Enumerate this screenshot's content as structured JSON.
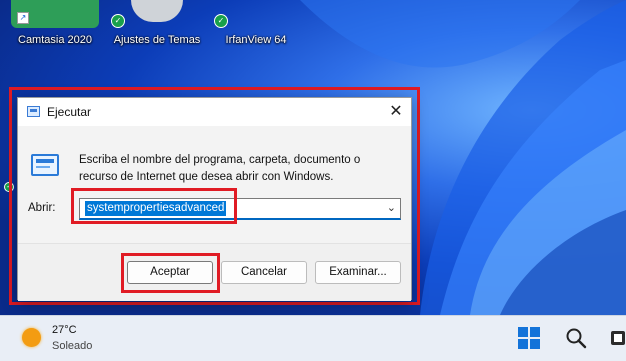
{
  "desktop": {
    "icons": [
      {
        "label": "Camtasia 2020",
        "icon": "camtasia-icon"
      },
      {
        "label": "Ajustes de Temas",
        "icon": "theme-settings-icon"
      },
      {
        "label": "IrfanView 64",
        "icon": "irfanview-icon"
      }
    ]
  },
  "dialog": {
    "title": "Ejecutar",
    "close_glyph": "✕",
    "description": "Escriba el nombre del programa, carpeta, documento o recurso de Internet que desea abrir con Windows.",
    "open_label": "Abrir:",
    "input_value": "systempropertiesadvanced",
    "ok_label": "Aceptar",
    "cancel_label": "Cancelar",
    "browse_label": "Examinar..."
  },
  "taskbar": {
    "temperature": "27°C",
    "condition": "Soleado"
  },
  "colors": {
    "highlight": "#e01b24",
    "accent": "#0078d7"
  }
}
